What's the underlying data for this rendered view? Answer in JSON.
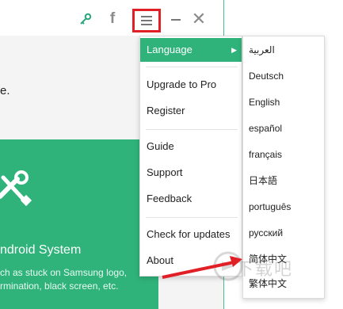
{
  "titlebar": {
    "icons": [
      "key-icon",
      "facebook-icon",
      "menu-icon",
      "minimize-icon",
      "close-icon"
    ],
    "facebook_glyph": "f",
    "close_glyph": "✕"
  },
  "main": {
    "partial_text": "e.",
    "card": {
      "title": "ndroid System",
      "desc_line1": "ch as stuck on Samsung logo,",
      "desc_line2": "rmination, black screen, etc."
    }
  },
  "menu": {
    "items": [
      {
        "label": "Language",
        "active": true
      },
      {
        "label": "Upgrade to Pro"
      },
      {
        "label": "Register"
      },
      {
        "label": "Guide"
      },
      {
        "label": "Support"
      },
      {
        "label": "Feedback"
      },
      {
        "label": "Check for updates"
      },
      {
        "label": "About"
      }
    ]
  },
  "language_menu": {
    "items": [
      {
        "label": "العربية"
      },
      {
        "label": "Deutsch"
      },
      {
        "label": "English"
      },
      {
        "label": "español"
      },
      {
        "label": "français"
      },
      {
        "label": "日本語"
      },
      {
        "label": "português"
      },
      {
        "label": "русский"
      },
      {
        "label": "简体中文"
      },
      {
        "label": "繁体中文"
      }
    ]
  },
  "watermark": {
    "text": "下载吧"
  },
  "colors": {
    "accent_green": "#2fb37a",
    "highlight_red": "#e01f26"
  }
}
